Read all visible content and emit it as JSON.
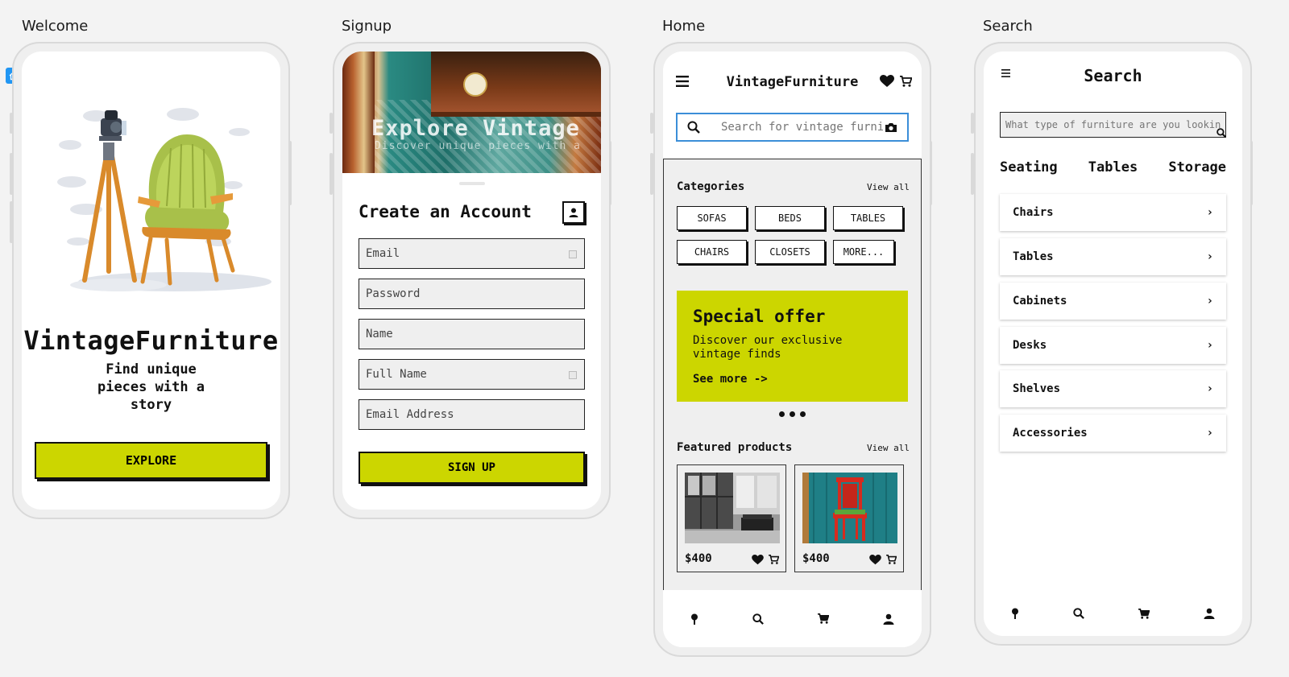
{
  "frames": {
    "welcome": "Welcome",
    "signup": "Signup",
    "home": "Home",
    "search": "Search"
  },
  "welcome": {
    "title": "VintageFurniture",
    "subtitle": "Find unique pieces with a story",
    "button": "EXPLORE"
  },
  "signup": {
    "hero_title": "Explore Vintage",
    "hero_subtitle": "Discover unique pieces with a",
    "title": "Create an Account",
    "fields": {
      "email": "Email",
      "password": "Password",
      "name": "Name",
      "full_name": "Full Name",
      "email_address": "Email Address"
    },
    "button": "SIGN UP"
  },
  "home": {
    "title": "VintageFurniture",
    "search_placeholder": "Search for vintage furniture",
    "categories_title": "Categories",
    "view_all": "View all",
    "chips": [
      "SOFAS",
      "BEDS",
      "TABLES",
      "CHAIRS",
      "CLOSETS",
      "MORE..."
    ],
    "offer": {
      "title": "Special offer",
      "text": "Discover our exclusive vintage finds",
      "link": "See more ->"
    },
    "featured_title": "Featured products",
    "featured_view_all": "View all",
    "products": [
      {
        "price": "$400"
      },
      {
        "price": "$400"
      }
    ]
  },
  "search": {
    "title": "Search",
    "placeholder": "What type of furniture are you looking for?",
    "tabs": [
      "Seating",
      "Tables",
      "Storage"
    ],
    "items": [
      "Chairs",
      "Tables",
      "Cabinets",
      "Desks",
      "Shelves",
      "Accessories"
    ]
  },
  "colors": {
    "accent": "#ccd600",
    "focus": "#3b8ed8",
    "badge": "#2196f3"
  }
}
